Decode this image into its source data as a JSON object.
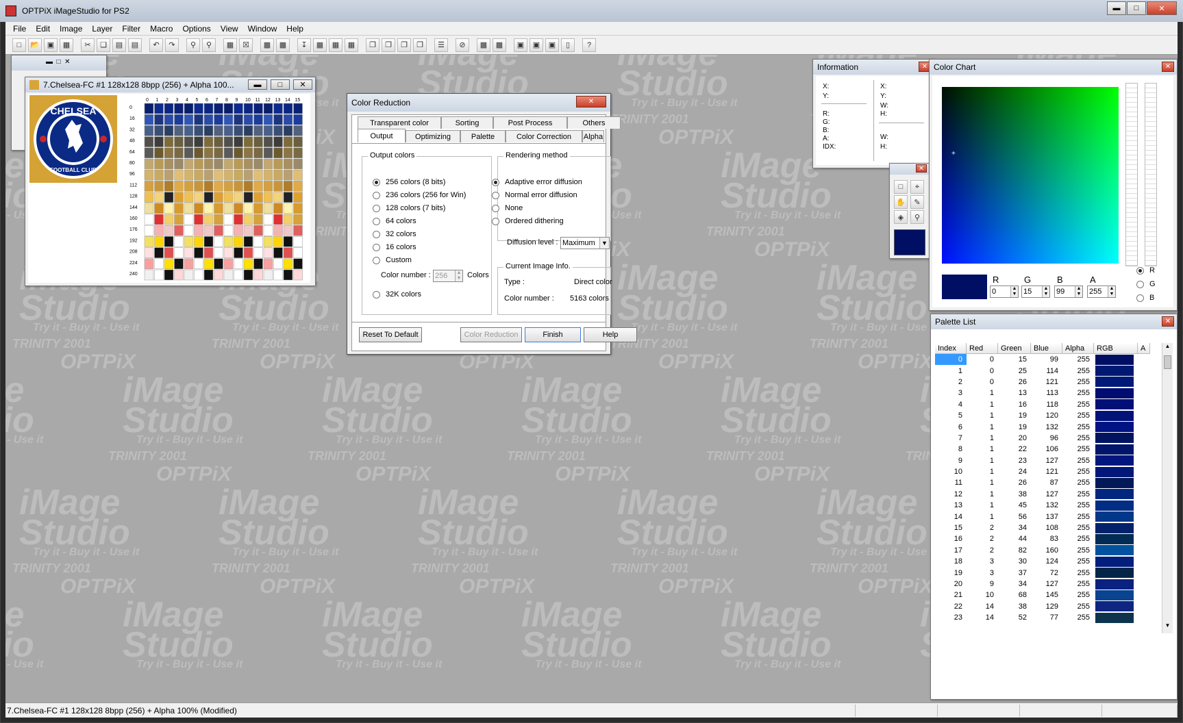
{
  "app": {
    "title": "OPTPiX iMageStudio for PS2"
  },
  "menu": [
    "File",
    "Edit",
    "Image",
    "Layer",
    "Filter",
    "Macro",
    "Options",
    "View",
    "Window",
    "Help"
  ],
  "watermark": {
    "line1": "TRINITY 2001",
    "line2": "OPTPiX",
    "line3": "iMage",
    "line4": "Studio",
    "line5": "Try it - Buy it - Use it"
  },
  "image_window": {
    "title": "7.Chelsea-FC #1  128x128  8bpp (256) + Alpha 100...",
    "logo_top": "CHELSEA",
    "logo_bottom": "FOOTBALL CLUB",
    "col_labels": [
      "0",
      "1",
      "2",
      "3",
      "4",
      "5",
      "6",
      "7",
      "8",
      "9",
      "10",
      "11",
      "12",
      "13",
      "14",
      "15"
    ],
    "row_labels": [
      "0",
      "16",
      "32",
      "48",
      "64",
      "80",
      "96",
      "112",
      "128",
      "144",
      "160",
      "176",
      "192",
      "208",
      "224",
      "240"
    ]
  },
  "dialog": {
    "title": "Color Reduction",
    "tabs_row1": [
      "Transparent color",
      "Sorting",
      "Post Process",
      "Others"
    ],
    "tabs_row2": [
      "Output",
      "Optimizing",
      "Palette",
      "Color Correction",
      "Alpha"
    ],
    "output_group": "Output colors",
    "output_options": [
      "256 colors (8 bits)",
      "236 colors (256 for Win)",
      "128 colors (7 bits)",
      "64 colors",
      "32 colors",
      "16 colors",
      "Custom"
    ],
    "color_number_label": "Color number :",
    "color_number_value": "256",
    "colors_suffix": "Colors",
    "opt_32k": "32K colors",
    "render_group": "Rendering method",
    "render_options": [
      "Adaptive error diffusion",
      "Normal error diffusion",
      "None",
      "Ordered dithering"
    ],
    "diffusion_label": "Diffusion level :",
    "diffusion_value": "Maximum",
    "info_group": "Current Image Info.",
    "type_label": "Type :",
    "type_value": "Direct color",
    "count_label": "Color number :",
    "count_value": "5163 colors",
    "btn_reset": "Reset To Default",
    "btn_reduce": "Color Reduction",
    "btn_finish": "Finish",
    "btn_help": "Help"
  },
  "info_panel": {
    "title": "Information",
    "left": [
      "X:",
      "Y:",
      "R:",
      "G:",
      "B:",
      "A:",
      "IDX:"
    ],
    "right": [
      "X:",
      "Y:",
      "W:",
      "H:",
      "W:",
      "H:"
    ]
  },
  "color_chart": {
    "title": "Color Chart",
    "labels": [
      "R",
      "G",
      "B",
      "A"
    ],
    "values": [
      "0",
      "15",
      "99",
      "255"
    ],
    "radios": [
      "R",
      "G",
      "B"
    ],
    "selected_color": "#000f63"
  },
  "palette_list": {
    "title": "Palette List",
    "headers": [
      "Index",
      "Red",
      "Green",
      "Blue",
      "Alpha",
      "RGB",
      "A"
    ],
    "rows": [
      [
        "0",
        "0",
        "15",
        "99",
        "255"
      ],
      [
        "1",
        "0",
        "25",
        "114",
        "255"
      ],
      [
        "2",
        "0",
        "26",
        "121",
        "255"
      ],
      [
        "3",
        "1",
        "13",
        "113",
        "255"
      ],
      [
        "4",
        "1",
        "16",
        "118",
        "255"
      ],
      [
        "5",
        "1",
        "19",
        "120",
        "255"
      ],
      [
        "6",
        "1",
        "19",
        "132",
        "255"
      ],
      [
        "7",
        "1",
        "20",
        "96",
        "255"
      ],
      [
        "8",
        "1",
        "22",
        "106",
        "255"
      ],
      [
        "9",
        "1",
        "23",
        "127",
        "255"
      ],
      [
        "10",
        "1",
        "24",
        "121",
        "255"
      ],
      [
        "11",
        "1",
        "26",
        "87",
        "255"
      ],
      [
        "12",
        "1",
        "38",
        "127",
        "255"
      ],
      [
        "13",
        "1",
        "45",
        "132",
        "255"
      ],
      [
        "14",
        "1",
        "56",
        "137",
        "255"
      ],
      [
        "15",
        "2",
        "34",
        "108",
        "255"
      ],
      [
        "16",
        "2",
        "44",
        "83",
        "255"
      ],
      [
        "17",
        "2",
        "82",
        "160",
        "255"
      ],
      [
        "18",
        "3",
        "30",
        "124",
        "255"
      ],
      [
        "19",
        "3",
        "37",
        "72",
        "255"
      ],
      [
        "20",
        "9",
        "34",
        "127",
        "255"
      ],
      [
        "21",
        "10",
        "68",
        "145",
        "255"
      ],
      [
        "22",
        "14",
        "38",
        "129",
        "255"
      ],
      [
        "23",
        "14",
        "52",
        "77",
        "255"
      ]
    ]
  },
  "status": {
    "text": "7.Chelsea-FC #1  128x128  8bpp (256) + Alpha 100%  (Modified)"
  }
}
